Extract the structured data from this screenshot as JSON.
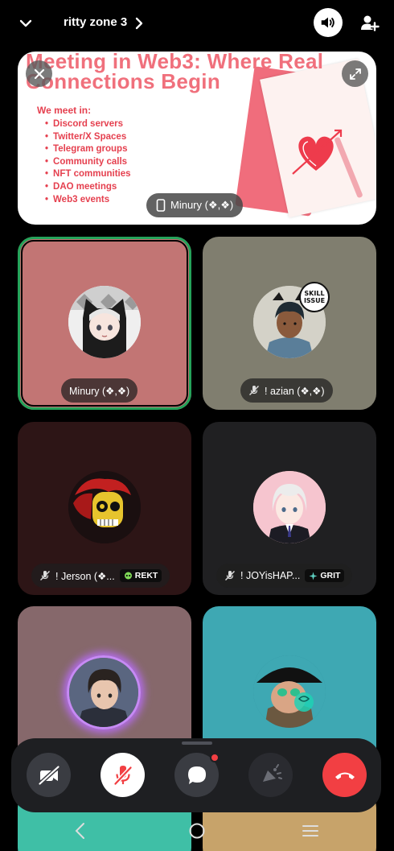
{
  "header": {
    "channel_name": "ritty zone 3",
    "icons": [
      "chevron-down-icon",
      "chevron-right-icon",
      "speaker-icon",
      "add-user-icon"
    ]
  },
  "screen_share": {
    "title": "Meeting in Web3: Where Real Connections Begin",
    "subtitle": "We meet in:",
    "list": [
      "Discord servers",
      "Twitter/X Spaces",
      "Telegram groups",
      "Community calls",
      "NFT communities",
      "DAO meetings",
      "Web3 events"
    ],
    "sharer": "Minury (❖,❖)",
    "icons": [
      "close-icon",
      "expand-icon",
      "phone-icon"
    ]
  },
  "participants": [
    {
      "name": "Minury (❖,❖)",
      "muted": false,
      "speaking": true,
      "tag": "",
      "tile_color": "#c27574"
    },
    {
      "name": "! azian (❖,❖)",
      "muted": true,
      "speaking": false,
      "tag": "",
      "tile_color": "#807e6f"
    },
    {
      "name": "! Jerson (❖...",
      "muted": true,
      "speaking": false,
      "tag": "REKT",
      "tag_icon": "skull-icon",
      "tile_color": "#2d1516"
    },
    {
      "name": "! JOYisHAP...",
      "muted": true,
      "speaking": false,
      "tag": "GRIT",
      "tag_icon": "sparkle-icon",
      "tile_color": "#202022"
    },
    {
      "name": "",
      "muted": true,
      "speaking": false,
      "tag": "",
      "tile_color": "#86686b"
    },
    {
      "name": "",
      "muted": true,
      "speaking": false,
      "tag": "",
      "tile_color": "#3ea8b3"
    }
  ],
  "controls": {
    "camera": "camera-off-icon",
    "mic": "mic-off-icon",
    "chat": "chat-icon",
    "soundboard": "soundboard-icon",
    "leave": "hang-up-icon",
    "chat_unread": true
  },
  "colors": {
    "speaking_outline": "#24a35a",
    "leave": "#f23f43",
    "control_bar": "#1e1f22"
  }
}
